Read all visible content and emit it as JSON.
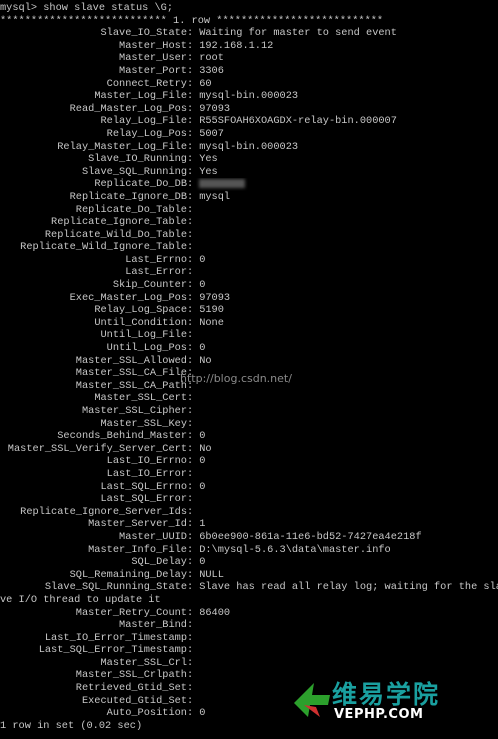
{
  "terminal": {
    "command_line": "mysql> show slave status \\G;",
    "header_line": "*************************** 1. row ***************************",
    "fields": [
      {
        "key": "Slave_IO_State",
        "value": "Waiting for master to send event"
      },
      {
        "key": "Master_Host",
        "value": "192.168.1.12"
      },
      {
        "key": "Master_User",
        "value": "root"
      },
      {
        "key": "Master_Port",
        "value": "3306"
      },
      {
        "key": "Connect_Retry",
        "value": "60"
      },
      {
        "key": "Master_Log_File",
        "value": "mysql-bin.000023"
      },
      {
        "key": "Read_Master_Log_Pos",
        "value": "97093"
      },
      {
        "key": "Relay_Log_File",
        "value": "R55SFOAH6XOAGDX-relay-bin.000007"
      },
      {
        "key": "Relay_Log_Pos",
        "value": "5007"
      },
      {
        "key": "Relay_Master_Log_File",
        "value": "mysql-bin.000023"
      },
      {
        "key": "Slave_IO_Running",
        "value": "Yes"
      },
      {
        "key": "Slave_SQL_Running",
        "value": "Yes"
      },
      {
        "key": "Replicate_Do_DB",
        "value": ""
      },
      {
        "key": "Replicate_Ignore_DB",
        "value": "mysql"
      },
      {
        "key": "Replicate_Do_Table",
        "value": ""
      },
      {
        "key": "Replicate_Ignore_Table",
        "value": ""
      },
      {
        "key": "Replicate_Wild_Do_Table",
        "value": ""
      },
      {
        "key": "Replicate_Wild_Ignore_Table",
        "value": ""
      },
      {
        "key": "Last_Errno",
        "value": "0"
      },
      {
        "key": "Last_Error",
        "value": ""
      },
      {
        "key": "Skip_Counter",
        "value": "0"
      },
      {
        "key": "Exec_Master_Log_Pos",
        "value": "97093"
      },
      {
        "key": "Relay_Log_Space",
        "value": "5190"
      },
      {
        "key": "Until_Condition",
        "value": "None"
      },
      {
        "key": "Until_Log_File",
        "value": ""
      },
      {
        "key": "Until_Log_Pos",
        "value": "0"
      },
      {
        "key": "Master_SSL_Allowed",
        "value": "No"
      },
      {
        "key": "Master_SSL_CA_File",
        "value": ""
      },
      {
        "key": "Master_SSL_CA_Path",
        "value": ""
      },
      {
        "key": "Master_SSL_Cert",
        "value": ""
      },
      {
        "key": "Master_SSL_Cipher",
        "value": ""
      },
      {
        "key": "Master_SSL_Key",
        "value": ""
      },
      {
        "key": "Seconds_Behind_Master",
        "value": "0"
      },
      {
        "key": "Master_SSL_Verify_Server_Cert",
        "value": "No"
      },
      {
        "key": "Last_IO_Errno",
        "value": "0"
      },
      {
        "key": "Last_IO_Error",
        "value": ""
      },
      {
        "key": "Last_SQL_Errno",
        "value": "0"
      },
      {
        "key": "Last_SQL_Error",
        "value": ""
      },
      {
        "key": "Replicate_Ignore_Server_Ids",
        "value": ""
      },
      {
        "key": "Master_Server_Id",
        "value": "1"
      },
      {
        "key": "Master_UUID",
        "value": "6b0ee900-861a-11e6-bd52-7427ea4e218f"
      },
      {
        "key": "Master_Info_File",
        "value": "D:\\mysql-5.6.3\\data\\master.info"
      },
      {
        "key": "SQL_Delay",
        "value": "0"
      },
      {
        "key": "SQL_Remaining_Delay",
        "value": "NULL"
      },
      {
        "key": "Slave_SQL_Running_State",
        "value": "Slave has read all relay log; waiting for the sla"
      },
      {
        "key": "Master_Retry_Count",
        "value": "86400"
      },
      {
        "key": "Master_Bind",
        "value": ""
      },
      {
        "key": "Last_IO_Error_Timestamp",
        "value": ""
      },
      {
        "key": "Last_SQL_Error_Timestamp",
        "value": ""
      },
      {
        "key": "Master_SSL_Crl",
        "value": ""
      },
      {
        "key": "Master_SSL_Crlpath",
        "value": ""
      },
      {
        "key": "Retrieved_Gtid_Set",
        "value": ""
      },
      {
        "key": "Executed_Gtid_Set",
        "value": ""
      },
      {
        "key": "Auto_Position",
        "value": "0"
      }
    ],
    "wrap_continuation": "ve I/O thread to update it",
    "footer_line": "1 row in set (0.02 sec)"
  },
  "watermark": {
    "text": "http://blog.csdn.net/"
  },
  "logo": {
    "chinese_text": "维易学院",
    "english_text": "VEPHP.COM",
    "colors": {
      "green": "#1aa0a0",
      "arrow": "#2ca02c"
    }
  }
}
